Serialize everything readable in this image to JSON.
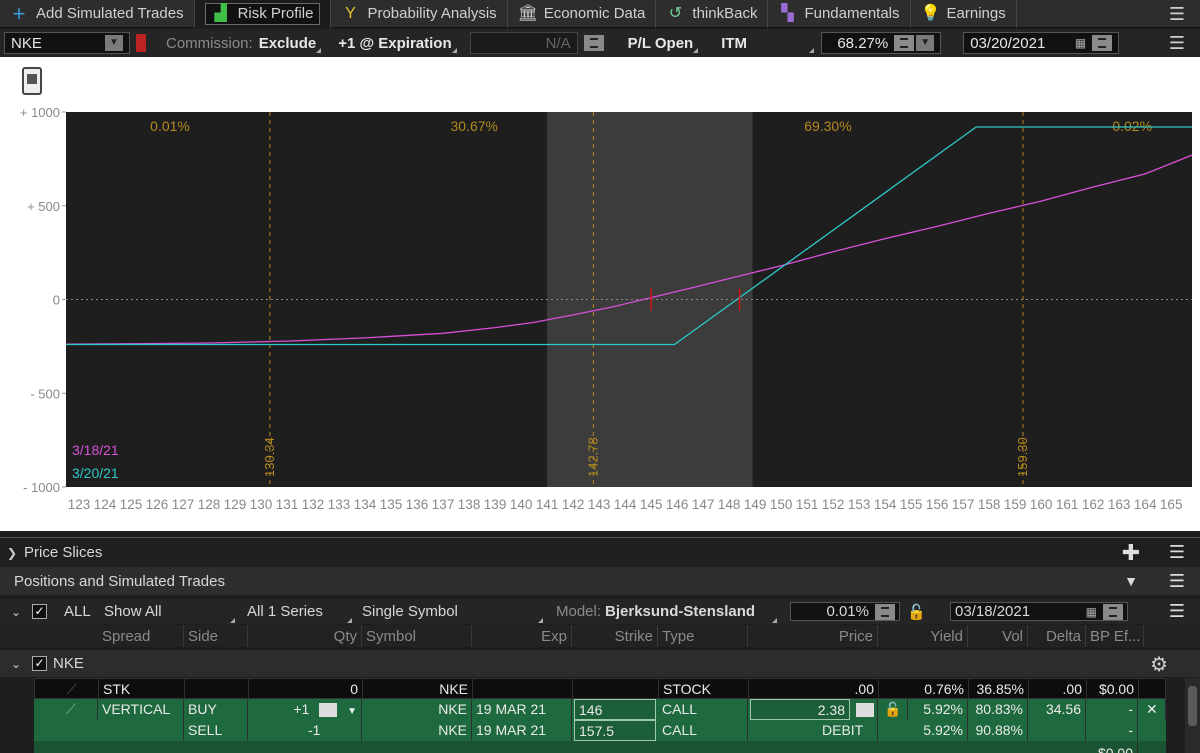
{
  "tabs": [
    {
      "label": "Add Simulated Trades",
      "icon": "plus-icon",
      "color": "#3a9ad9"
    },
    {
      "label": "Risk Profile",
      "icon": "risk-profile-icon",
      "color": "#3fbf4a"
    },
    {
      "label": "Probability Analysis",
      "icon": "probability-fork-icon",
      "color": "#e6c229"
    },
    {
      "label": "Economic Data",
      "icon": "bank-building-icon",
      "color": "#cfcfcf"
    },
    {
      "label": "thinkBack",
      "icon": "history-clock-icon",
      "color": "#6fcf97"
    },
    {
      "label": "Fundamentals",
      "icon": "fundamentals-blocks-icon",
      "color": "#9b6bd6"
    },
    {
      "label": "Earnings",
      "icon": "lightbulb-icon",
      "color": "#4aa8e8"
    }
  ],
  "controls": {
    "symbol": "NKE",
    "commission_label": "Commission:",
    "commission_value": "Exclude",
    "expiration_mode": "+1 @ Expiration",
    "na_value": "N/A",
    "pl_mode": "P/L Open",
    "itm": "ITM",
    "probability": "68.27%",
    "date": "03/20/2021"
  },
  "chart": {
    "y_ticks": [
      {
        "v": 1000,
        "label": "+ 1000"
      },
      {
        "v": 500,
        "label": "+ 500"
      },
      {
        "v": 0,
        "label": "0"
      },
      {
        "v": -500,
        "label": "- 500"
      },
      {
        "v": -1000,
        "label": "- 1000"
      }
    ],
    "x_min": 122.5,
    "x_max": 165.8,
    "y_min": -1000,
    "y_max": 1000,
    "x_ticks": [
      123,
      124,
      125,
      126,
      127,
      128,
      129,
      130,
      131,
      132,
      133,
      134,
      135,
      136,
      137,
      138,
      139,
      140,
      141,
      142,
      143,
      144,
      145,
      146,
      147,
      148,
      149,
      150,
      151,
      152,
      153,
      154,
      155,
      156,
      157,
      158,
      159,
      160,
      161,
      162,
      163,
      164,
      165
    ],
    "zones": [
      {
        "label": "0.01%",
        "x": 126.5
      },
      {
        "label": "30.67%",
        "x": 138.2
      },
      {
        "label": "69.30%",
        "x": 151.8
      },
      {
        "label": "0.02%",
        "x": 163.5
      }
    ],
    "shade": {
      "from": 141.0,
      "to": 148.9
    },
    "vlines": [
      {
        "x": 130.34,
        "label": "130.34"
      },
      {
        "x": 142.78,
        "label": "142.78"
      },
      {
        "x": 159.3,
        "label": "159.30"
      }
    ],
    "series": [
      {
        "name": "3/18/21",
        "color": "#d94fd9",
        "x": [
          122.5,
          125,
          128,
          131,
          134,
          137,
          139,
          140.5,
          142,
          143.5,
          145,
          146.5,
          148,
          150,
          152,
          154,
          156,
          158,
          160,
          162,
          164,
          165.8
        ],
        "y": [
          -238,
          -236,
          -232,
          -222,
          -205,
          -180,
          -150,
          -122,
          -82,
          -40,
          10,
          60,
          112,
          180,
          255,
          325,
          390,
          460,
          525,
          600,
          670,
          770
        ]
      },
      {
        "name": "3/20/21",
        "color": "#2ec8c8",
        "x": [
          122.5,
          145.9,
          157.5,
          165.8
        ],
        "y": [
          -240,
          -240,
          920,
          920
        ]
      }
    ],
    "breakevens": [
      {
        "x": 145.0,
        "y": 0
      },
      {
        "x": 148.4,
        "y": 0
      }
    ]
  },
  "price_slices": {
    "label": "Price Slices"
  },
  "positions": {
    "label": "Positions and Simulated Trades"
  },
  "filter": {
    "all": "ALL",
    "show_all": "Show All",
    "series": "All 1 Series",
    "symbol_mode": "Single Symbol",
    "model_label": "Model:",
    "model_value": "Bjerksund-Stensland",
    "vol_shift": "0.01%",
    "date": "03/18/2021"
  },
  "columns": [
    "Spread",
    "Side",
    "Qty",
    "Symbol",
    "Exp",
    "Strike",
    "Type",
    "Price",
    "Yield",
    "Vol",
    "Delta",
    "BP Ef..."
  ],
  "group": {
    "name": "NKE"
  },
  "trades": [
    {
      "spread": "STK",
      "side": "",
      "qty": "0",
      "symbol": "NKE",
      "exp": "",
      "strike": "",
      "type": "STOCK",
      "price": ".00",
      "yield": "0.76%",
      "vol": "36.85%",
      "delta": ".00",
      "bp": "$0.00"
    },
    {
      "spread": "VERTICAL",
      "side": "BUY",
      "qty": "+1",
      "symbol": "NKE",
      "exp": "19 MAR 21",
      "strike": "146",
      "type": "CALL",
      "price": "2.38",
      "yield": "5.92%",
      "vol": "80.83%",
      "delta": "34.56",
      "bp": "-"
    },
    {
      "spread": "",
      "side": "SELL",
      "qty": "-1",
      "symbol": "NKE",
      "exp": "19 MAR 21",
      "strike": "157.5",
      "type": "CALL",
      "price": "DEBIT",
      "yield": "5.92%",
      "vol": "90.88%",
      "delta": "",
      "bp": "-"
    }
  ],
  "total": {
    "bp": "$0.00"
  }
}
